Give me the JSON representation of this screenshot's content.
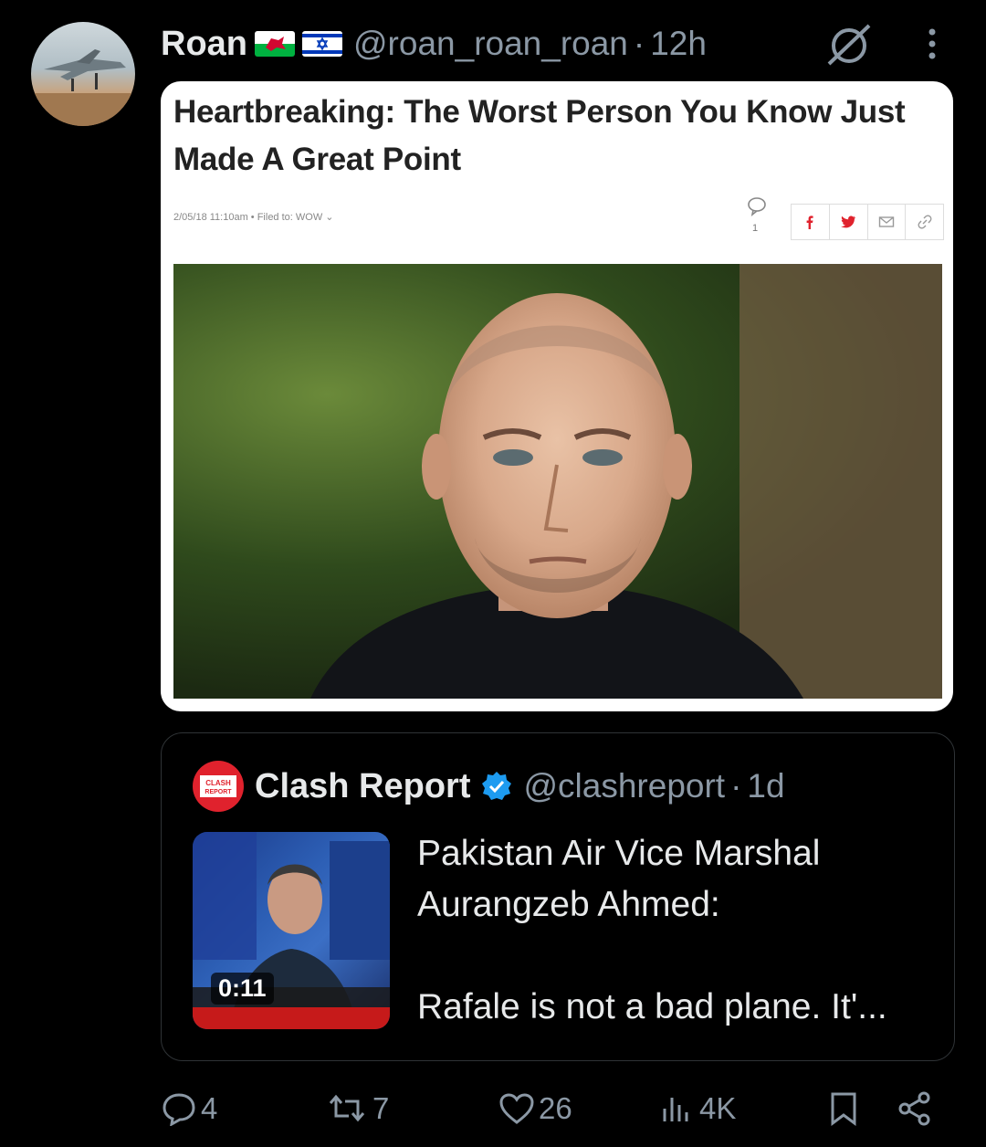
{
  "post": {
    "author": "Roan",
    "flags": [
      "wales-flag",
      "israel-flag"
    ],
    "handle": "@roan_roan_roan",
    "separator": "·",
    "time": "12h"
  },
  "article": {
    "title": "Heartbreaking: The Worst Person You Know Just Made A Great Point",
    "meta": "2/05/18 11:10am • Filed to: WOW ⌄",
    "comment_count": "1",
    "share_icons": [
      "facebook-icon",
      "twitter-icon",
      "mail-icon",
      "link-icon"
    ]
  },
  "quoted": {
    "logo_text": "CLASH REPORT",
    "name": "Clash Report",
    "handle": "@clashreport",
    "separator": "·",
    "time": "1d",
    "video_duration": "0:11",
    "text": "Pakistan Air Vice Marshal Aurangzeb Ahmed:\n\nRafale is not a bad plane. It'..."
  },
  "actions": {
    "replies": "4",
    "reposts": "7",
    "likes": "26",
    "views": "4K"
  },
  "colors": {
    "background": "#000000",
    "muted": "#8b98a5",
    "text": "#e7e9ea",
    "verified": "#1d9bf0",
    "clash_red": "#e0222d"
  }
}
